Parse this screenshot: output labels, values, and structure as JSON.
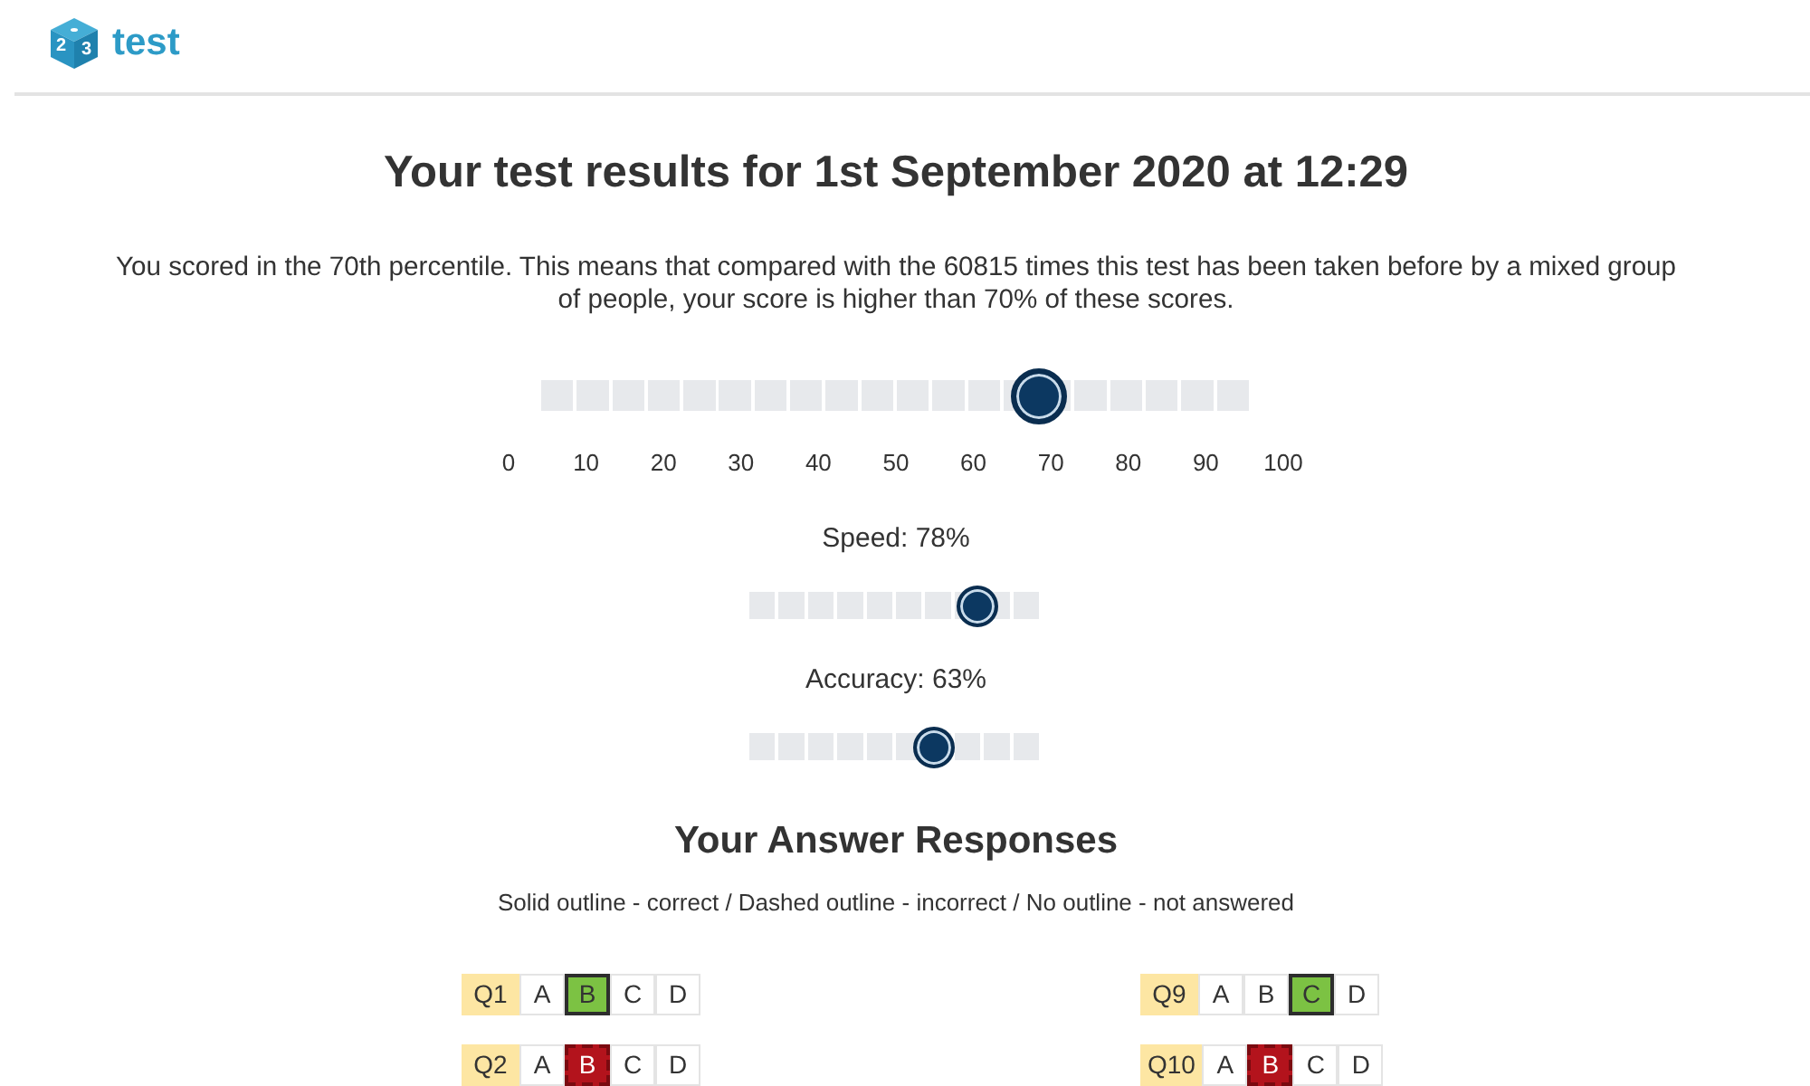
{
  "header": {
    "logo": {
      "dice_numbers": [
        "2",
        "3"
      ],
      "name": "test"
    }
  },
  "title": "Your test results for 1st September 2020 at 12:29",
  "summary": "You scored in the 70th percentile. This means that compared with the 60815 times this test has been taken before by a mixed group of people, your score is higher than 70% of these scores.",
  "percentile_slider": {
    "level": 0.7,
    "scale_labels": [
      "0",
      "10",
      "20",
      "30",
      "40",
      "50",
      "60",
      "70",
      "80",
      "90",
      "100"
    ]
  },
  "sub_scores": [
    {
      "label": "Speed: 78%",
      "level": 0.78
    },
    {
      "label": "Accuracy: 63%",
      "level": 0.63
    }
  ],
  "responses": {
    "heading": "Your Answer Responses",
    "legend": "Solid outline - correct / Dashed outline - incorrect / No outline - not answered",
    "questions": [
      {
        "label": "Q1",
        "correct": true,
        "options": [
          {
            "label": "A",
            "selected": false
          },
          {
            "label": "B",
            "selected": true
          },
          {
            "label": "C",
            "selected": false
          },
          {
            "label": "D",
            "selected": false
          }
        ]
      },
      {
        "label": "Q9",
        "correct": true,
        "options": [
          {
            "label": "A",
            "selected": false
          },
          {
            "label": "B",
            "selected": false
          },
          {
            "label": "C",
            "selected": true
          },
          {
            "label": "D",
            "selected": false
          }
        ]
      },
      {
        "label": "Q2",
        "correct": false,
        "options": [
          {
            "label": "A",
            "selected": false
          },
          {
            "label": "B",
            "selected": true
          },
          {
            "label": "C",
            "selected": false
          },
          {
            "label": "D",
            "selected": false
          }
        ]
      },
      {
        "label": "Q10",
        "correct": false,
        "options": [
          {
            "label": "A",
            "selected": false
          },
          {
            "label": "B",
            "selected": true
          },
          {
            "label": "C",
            "selected": false
          },
          {
            "label": "D",
            "selected": false
          }
        ]
      }
    ]
  }
}
